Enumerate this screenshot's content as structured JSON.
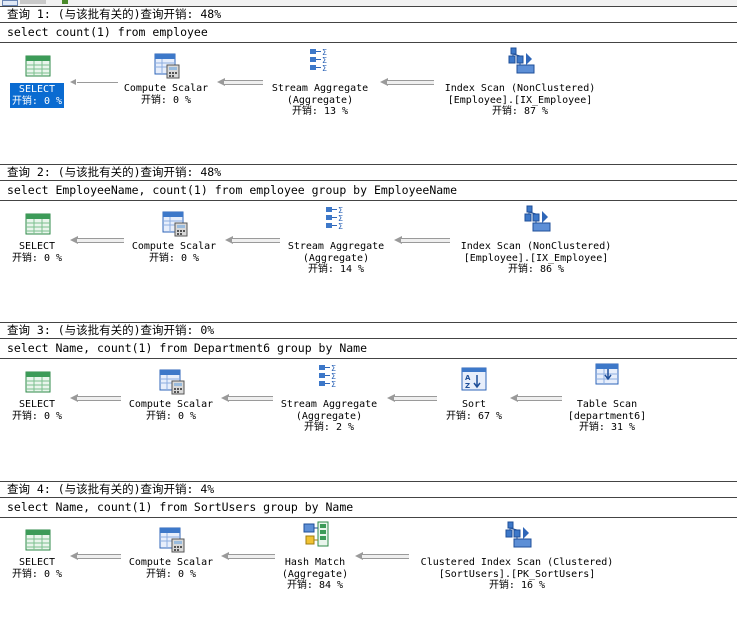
{
  "queries": [
    {
      "header": "查询 1: (与该批有关的)查询开销: 48%",
      "sql": "select count(1) from employee",
      "nodes": [
        {
          "l1": "SELECT",
          "l2": "",
          "cost": "开销: 0 %",
          "icon": "select-icon",
          "selected": true
        },
        {
          "l1": "Compute Scalar",
          "l2": "",
          "cost": "开销: 0 %",
          "icon": "compute-scalar-icon"
        },
        {
          "l1": "Stream Aggregate",
          "l2": "(Aggregate)",
          "cost": "开销: 13 %",
          "icon": "stream-aggregate-icon"
        },
        {
          "l1": "Index Scan (NonClustered)",
          "l2": "[Employee].[IX_Employee]",
          "cost": "开销: 87 %",
          "icon": "index-scan-icon"
        }
      ]
    },
    {
      "header": "查询 2: (与该批有关的)查询开销: 48%",
      "sql": "select EmployeeName, count(1) from employee group by EmployeeName",
      "nodes": [
        {
          "l1": "SELECT",
          "l2": "",
          "cost": "开销: 0 %",
          "icon": "select-icon"
        },
        {
          "l1": "Compute Scalar",
          "l2": "",
          "cost": "开销: 0 %",
          "icon": "compute-scalar-icon"
        },
        {
          "l1": "Stream Aggregate",
          "l2": "(Aggregate)",
          "cost": "开销: 14 %",
          "icon": "stream-aggregate-icon"
        },
        {
          "l1": "Index Scan (NonClustered)",
          "l2": "[Employee].[IX_Employee]",
          "cost": "开销: 86 %",
          "icon": "index-scan-icon"
        }
      ]
    },
    {
      "header": "查询 3: (与该批有关的)查询开销: 0%",
      "sql": "select Name, count(1) from Department6 group by Name",
      "nodes": [
        {
          "l1": "SELECT",
          "l2": "",
          "cost": "开销: 0 %",
          "icon": "select-icon"
        },
        {
          "l1": "Compute Scalar",
          "l2": "",
          "cost": "开销: 0 %",
          "icon": "compute-scalar-icon"
        },
        {
          "l1": "Stream Aggregate",
          "l2": "(Aggregate)",
          "cost": "开销: 2 %",
          "icon": "stream-aggregate-icon"
        },
        {
          "l1": "Sort",
          "l2": "",
          "cost": "开销: 67 %",
          "icon": "sort-icon"
        },
        {
          "l1": "Table Scan",
          "l2": "[department6]",
          "cost": "开销: 31 %",
          "icon": "table-scan-icon"
        }
      ]
    },
    {
      "header": "查询 4: (与该批有关的)查询开销: 4%",
      "sql": "select Name, count(1) from SortUsers group by Name",
      "nodes": [
        {
          "l1": "SELECT",
          "l2": "",
          "cost": "开销: 0 %",
          "icon": "select-icon"
        },
        {
          "l1": "Compute Scalar",
          "l2": "",
          "cost": "开销: 0 %",
          "icon": "compute-scalar-icon"
        },
        {
          "l1": "Hash Match",
          "l2": "(Aggregate)",
          "cost": "开销: 84 %",
          "icon": "hash-match-icon"
        },
        {
          "l1": "Clustered Index Scan (Clustered)",
          "l2": "[SortUsers].[PK_SortUsers]",
          "cost": "开销: 16 %",
          "icon": "clustered-index-scan-icon"
        }
      ]
    }
  ],
  "colors": {
    "selection": "#0a6bd1",
    "icon_green": "#3c9b58",
    "icon_blue": "#2f66b8"
  }
}
